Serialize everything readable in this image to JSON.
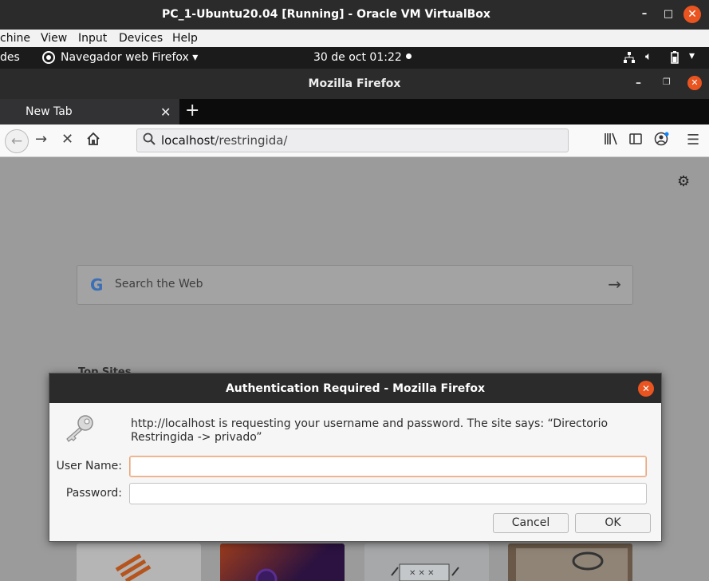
{
  "vbox": {
    "title": "PC_1-Ubuntu20.04 [Running] - Oracle VM VirtualBox",
    "controls": {
      "minimize": "–",
      "maximize": "□",
      "close": "✕"
    },
    "menu": [
      "chine",
      "View",
      "Input",
      "Devices",
      "Help"
    ]
  },
  "ubuntu_topbar": {
    "activities": "des",
    "app_menu": "Navegador web Firefox",
    "clock": "30 de oct  01:22"
  },
  "firefox": {
    "window_title": "Mozilla Firefox",
    "tab": {
      "label": "New Tab"
    },
    "url": {
      "host": "localhost",
      "path": "/restringida/"
    },
    "search_placeholder": "Search the Web",
    "top_sites_label": "Top Sites"
  },
  "dialog": {
    "title": "Authentication Required - Mozilla Firefox",
    "message": "http://localhost is requesting your username and password. The site says: “Directorio Restringida -> privado”",
    "username_label": "User Name:",
    "password_label": "Password:",
    "username_value": "",
    "password_value": "",
    "cancel_label": "Cancel",
    "ok_label": "OK"
  },
  "colors": {
    "accent": "#e95420"
  }
}
